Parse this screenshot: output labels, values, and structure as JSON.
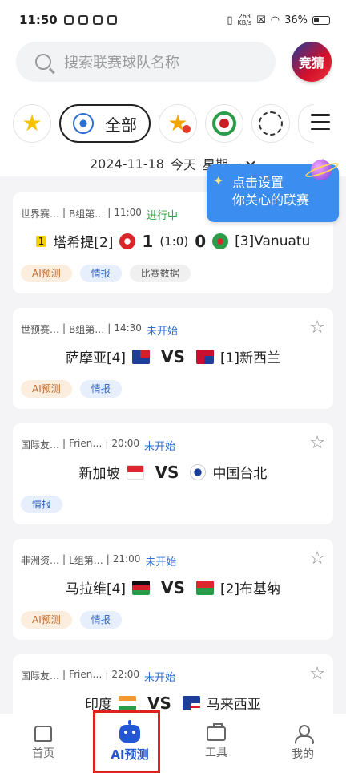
{
  "status_bar": {
    "time": "11:50",
    "speed_top": "263",
    "speed_bottom": "KB/s",
    "battery": "36%"
  },
  "search": {
    "placeholder": "搜索联赛球队名称"
  },
  "header": {
    "jingcai_label": "竞猜"
  },
  "league_tabs": {
    "all_label": "全部"
  },
  "date_bar": {
    "date": "2024-11-18",
    "today": "今天",
    "weekday": "星期一"
  },
  "tooltip": {
    "line1": "点击设置",
    "line2": "你关心的联赛"
  },
  "matches": [
    {
      "league": "世界赛…",
      "group": "B组第…",
      "time": "11:00",
      "status": "进行中",
      "home_badge": "1",
      "home": "塔希提[2]",
      "home_score": "1",
      "half_score": "(1:0)",
      "away_score": "0",
      "away": "[3]Vanuatu",
      "tags": [
        "AI预测",
        "情报",
        "比赛数据"
      ]
    },
    {
      "league": "世预赛…",
      "group": "B组第…",
      "time": "14:30",
      "status": "未开始",
      "home": "萨摩亚[4]",
      "vs": "VS",
      "away": "[1]新西兰",
      "tags": [
        "AI预测",
        "情报"
      ]
    },
    {
      "league": "国际友…",
      "group": "Frien…",
      "time": "20:00",
      "status": "未开始",
      "home": "新加坡",
      "vs": "VS",
      "away": "中国台北",
      "tags": [
        "情报"
      ]
    },
    {
      "league": "非洲资…",
      "group": "L组第…",
      "time": "21:00",
      "status": "未开始",
      "home": "马拉维[4]",
      "vs": "VS",
      "away": "[2]布基纳",
      "tags": [
        "AI预测",
        "情报"
      ]
    },
    {
      "league": "国际友…",
      "group": "Frien…",
      "time": "22:00",
      "status": "未开始",
      "home": "印度",
      "vs": "VS",
      "away": "马来西亚",
      "tags": []
    }
  ],
  "bottom_nav": [
    {
      "label": "首页",
      "icon": "home-icon"
    },
    {
      "label": "AI预测",
      "icon": "robot-icon"
    },
    {
      "label": "工具",
      "icon": "toolbox-icon"
    },
    {
      "label": "我的",
      "icon": "user-icon"
    }
  ],
  "colors": {
    "accent": "#2457d6",
    "live": "#2ca54a",
    "tooltip": "#3b8ef0",
    "highlight_box": "#e12020"
  }
}
